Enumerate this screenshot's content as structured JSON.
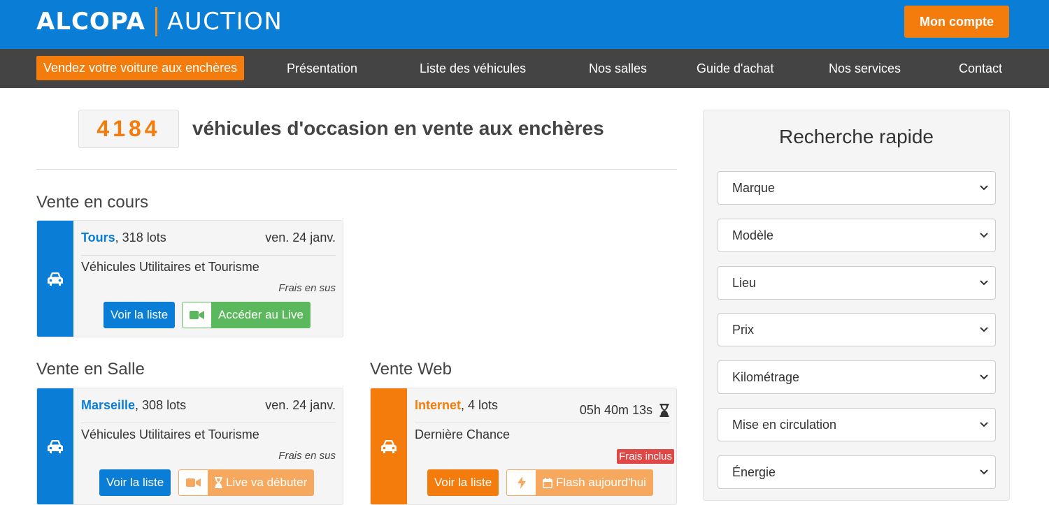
{
  "header": {
    "logo_main": "ALCOPA",
    "logo_sub": "AUCTION",
    "account_label": "Mon compte"
  },
  "nav": {
    "sell_label": "Vendez votre voiture aux enchères",
    "items": [
      "Présentation",
      "Liste des véhicules",
      "Nos salles",
      "Guide d'achat",
      "Nos services",
      "Contact"
    ]
  },
  "summary": {
    "count": "4184",
    "text": "véhicules d'occasion en vente aux enchères"
  },
  "sections": {
    "current": "Vente en cours",
    "room": "Vente en Salle",
    "web": "Vente Web"
  },
  "sales": {
    "tours": {
      "city": "Tours",
      "lots": ", 318 lots",
      "date": "ven. 24 janv.",
      "desc": "Véhicules Utilitaires et Tourisme",
      "fees": "Frais en sus",
      "btn_list": "Voir la liste",
      "btn_live": "Accéder au Live"
    },
    "marseille": {
      "city": "Marseille",
      "lots": ", 308 lots",
      "date": "ven. 24 janv.",
      "desc": "Véhicules Utilitaires et Tourisme",
      "fees": "Frais en sus",
      "btn_list": "Voir la liste",
      "btn_live": "Live va débuter"
    },
    "internet": {
      "city": "Internet",
      "lots": ", 4 lots",
      "timer": "05h 40m 13s",
      "desc": "Dernière Chance",
      "fees": "Frais inclus",
      "btn_list": "Voir la liste",
      "btn_flash": "Flash aujourd'hui"
    }
  },
  "search": {
    "title": "Recherche rapide",
    "fields": [
      "Marque",
      "Modèle",
      "Lieu",
      "Prix",
      "Kilométrage",
      "Mise en circulation",
      "Énergie"
    ]
  },
  "colors": {
    "brand_blue": "#0a7dd6",
    "brand_orange": "#f47c0c",
    "nav_bg": "#444444",
    "live_green": "#5cb85c",
    "fees_red": "#e04848"
  }
}
